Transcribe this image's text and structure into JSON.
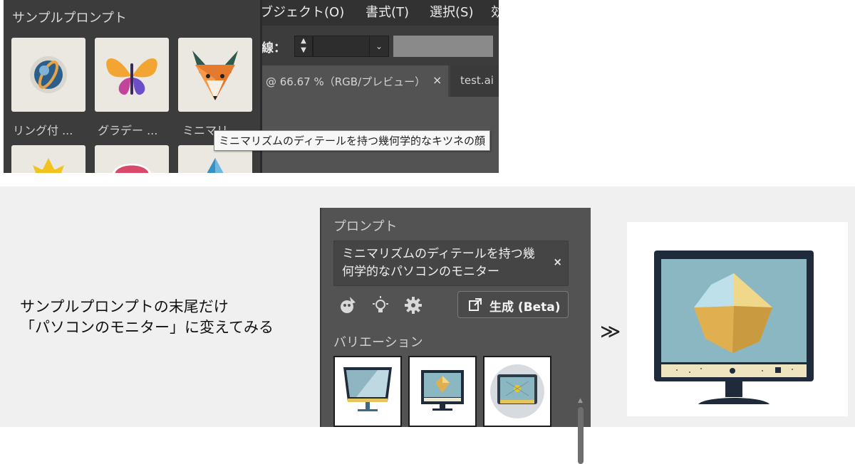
{
  "top": {
    "menu": [
      "ブジェクト(O)",
      "書式(T)",
      "選択(S)",
      "効"
    ],
    "stroke_label": "線：",
    "tabs": [
      {
        "title": "@ 66.67 %（RGB/プレビュー）",
        "close": "×"
      },
      {
        "title": "test.ai"
      }
    ],
    "sample_panel": {
      "title": "サンプルプロンプト",
      "items": [
        {
          "label": "リング付 ...",
          "icon": "ring-sphere-icon"
        },
        {
          "label": "グラデー ...",
          "icon": "butterfly-icon"
        },
        {
          "label": "ミニマリ ...",
          "icon": "fox-icon"
        },
        {
          "icon": "yellow-flower-icon"
        },
        {
          "icon": "pink-cap-icon"
        },
        {
          "icon": "blue-crystal-icon"
        }
      ]
    },
    "tooltip": "ミニマリズムのディテールを持つ幾何学的なキツネの顔"
  },
  "bottom": {
    "caption_lines": [
      "サンプルプロンプトの末尾だけ",
      "「パソコンのモニター」に変えてみる"
    ],
    "panel": {
      "heading": "プロンプト",
      "prompt_lines": [
        "ミニマリズムのディテールを持つ幾",
        "何学的なパソコンのモニター"
      ],
      "clear": "×",
      "generate_label": "生成 (Beta)",
      "variations_heading": "バリエーション",
      "icons": [
        "style-picker-icon",
        "lightbulb-icon",
        "gear-icon",
        "generate-icon"
      ]
    },
    "arrow": "≫",
    "result_icon": "monitor-crystal-icon"
  },
  "colors": {
    "panel_dark": "#3c3c3c",
    "panel_mid": "#535353",
    "monitor_frame": "#1f2b3a",
    "monitor_screen": "#8ab7c1",
    "crystal_gold": "#e0b050"
  }
}
